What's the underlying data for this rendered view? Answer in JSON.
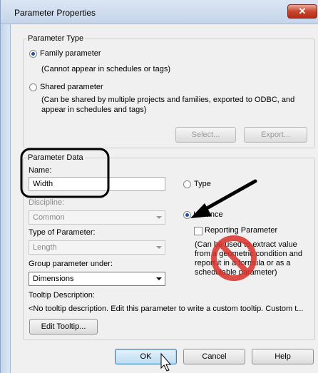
{
  "window": {
    "title": "Parameter Properties",
    "close_symbol": "✕"
  },
  "parameter_type": {
    "group_title": "Parameter Type",
    "family_label": "Family parameter",
    "family_note": "(Cannot appear in schedules or tags)",
    "shared_label": "Shared parameter",
    "shared_note_line1": "(Can be shared by multiple projects and families, exported to ODBC, and",
    "shared_note_line2": "appear in schedules and tags)",
    "select_button": "Select...",
    "export_button": "Export..."
  },
  "parameter_data": {
    "group_title": "Parameter Data",
    "name_label": "Name:",
    "name_value": "Width",
    "discipline_label": "Discipline:",
    "discipline_value": "Common",
    "type_of_parameter_label": "Type of Parameter:",
    "type_of_parameter_value": "Length",
    "group_under_label": "Group parameter under:",
    "group_under_value": "Dimensions",
    "type_radio_label": "Type",
    "instance_radio_label": "Instance",
    "reporting_label": "Reporting Parameter",
    "reporting_note_line1": "(Can be used to extract value",
    "reporting_note_line2": "from a geometric condition and",
    "reporting_note_line3": "report it in a formula or as a",
    "reporting_note_line4": "schedulable parameter)",
    "tooltip_label": "Tooltip Description:",
    "tooltip_text": "<No tooltip description. Edit this parameter to write a custom tooltip. Custom t...",
    "edit_tooltip_button": "Edit Tooltip..."
  },
  "footer": {
    "ok": "OK",
    "cancel": "Cancel",
    "help": "Help"
  },
  "colors": {
    "annotation_black": "#000000",
    "prohibition_red": "#d9312b",
    "default_button_blue": "#3c7fb1"
  },
  "selection": {
    "parameter_type": "family",
    "parameter_scope": "instance",
    "reporting_checked": false
  },
  "icons": [
    "close-icon",
    "arrow-annotation-icon",
    "prohibition-icon",
    "mouse-cursor-icon"
  ]
}
